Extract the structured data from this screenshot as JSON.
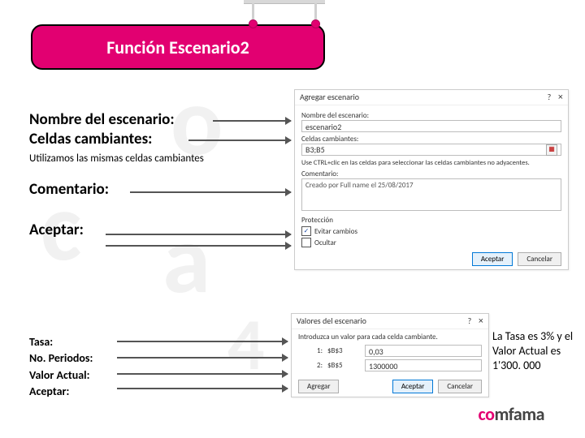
{
  "title": "Función Escenario2",
  "labels": {
    "nombre": "Nombre del escenario:",
    "celdas": "Celdas cambiantes:",
    "celdas_sub": "Utilizamos las mismas celdas cambiantes",
    "comentario": "Comentario:",
    "aceptar": "Aceptar:",
    "tasa": "Tasa:",
    "periodos": "No. Periodos:",
    "valor": "Valor Actual:",
    "aceptar2": "Aceptar:"
  },
  "dialog1": {
    "title": "Agregar escenario",
    "qmark": "?",
    "close": "×",
    "l_nombre": "Nombre del escenario:",
    "v_nombre": "escenario2",
    "l_celdas": "Celdas cambiantes:",
    "v_celdas": "B3;B5",
    "hint": "Use CTRL+clic en las celdas para seleccionar las celdas cambiantes no adyacentes.",
    "l_coment": "Comentario:",
    "v_coment": "Creado por Full name el 25/08/2017",
    "prot": "Protección",
    "chk1": "Evitar cambios",
    "chk2": "Ocultar",
    "btn_ok": "Aceptar",
    "btn_cancel": "Cancelar"
  },
  "dialog2": {
    "title": "Valores del escenario",
    "qmark": "?",
    "close": "×",
    "intro": "Introduzca un valor para cada celda cambiante.",
    "r1n": "1:",
    "r1c": "$B$3",
    "r1v": "0,03",
    "r2n": "2:",
    "r2c": "$B$5",
    "r2v": "1300000",
    "btn_add": "Agregar",
    "btn_ok": "Aceptar",
    "btn_cancel": "Cancelar"
  },
  "note": "La Tasa es  3% y el Valor Actual  es 1'300. 000",
  "brand": {
    "c1": "c",
    "o": "o",
    "rest": "mfama"
  }
}
